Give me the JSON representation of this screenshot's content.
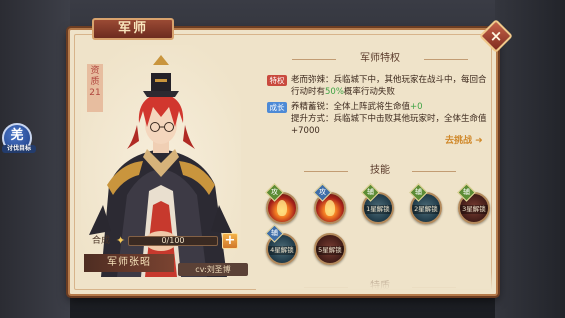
{
  "window": {
    "title": "军师",
    "close_label": "×"
  },
  "side_badge": {
    "glyph": "羌",
    "caption": "讨伐目标"
  },
  "general": {
    "rank_label": "资质21",
    "name": "军师张昭",
    "cv": "cv:刘圣博"
  },
  "merge": {
    "label": "合成",
    "icon": "puzzle-piece-icon",
    "progress_text": "0/100",
    "progress_value": 0,
    "plus_label": "+"
  },
  "perks": {
    "section_title": "军师特权",
    "items": [
      {
        "tag": "特权",
        "tag_color": "#c94a3e",
        "text": "老而弥辣：兵临城下中，其他玩家在战斗中，每回合行动时有",
        "highlight": "50%",
        "text_after": "概率行动失败"
      },
      {
        "tag": "成长",
        "tag_color": "#4d8ad6",
        "text": "养精蓄锐：全体上阵武将生命值",
        "highlight": "+0",
        "text_after": ""
      }
    ],
    "extra_line": "提升方式：兵临城下中击败其他玩家时，全体生命值+7000",
    "goto_label": "去挑战"
  },
  "skills": {
    "section_title": "技能",
    "items": [
      {
        "kind": "fire",
        "badge": "攻",
        "badge_color": "#5d8c35",
        "unlock_label": ""
      },
      {
        "kind": "fire",
        "badge": "攻",
        "badge_color": "#3f6ea8",
        "unlock_label": ""
      },
      {
        "kind": "locked",
        "badge": "辅",
        "badge_color": "#5d8c35",
        "unlock_label": "1星解锁"
      },
      {
        "kind": "locked",
        "badge": "辅",
        "badge_color": "#5d8c35",
        "unlock_label": "2星解锁"
      },
      {
        "kind": "locked-red",
        "badge": "辅",
        "badge_color": "#5d8c35",
        "unlock_label": "3星解锁"
      },
      {
        "kind": "locked",
        "badge": "辅",
        "badge_color": "#3f6ea8",
        "unlock_label": "4星解锁"
      },
      {
        "kind": "locked-red",
        "badge": "",
        "badge_color": "#3f6ea8",
        "unlock_label": "5星解锁"
      }
    ]
  },
  "next_section_title": "特ave"
}
